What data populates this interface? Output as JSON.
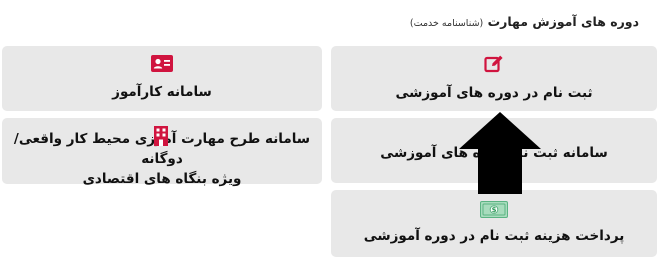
{
  "header": {
    "title": "دوره های آموزش مهارت",
    "subtitle": "(شناسنامه خدمت)"
  },
  "cards": {
    "register_course": {
      "label": "ثبت نام در دوره های آموزشی",
      "icon": "edit-icon"
    },
    "courses_system": {
      "label": "سامانه ثبت نام دوره های آموزشی",
      "icon": "none"
    },
    "payment": {
      "label": "پرداخت هزینه ثبت نام در دوره آموزشی",
      "icon": "banknote-icon"
    },
    "karamooz": {
      "label": "سامانه کارآموز",
      "icon": "id-card-icon"
    },
    "workplace_plan": {
      "label_line1": "سامانه طرح مهارت آموزی محیط کار واقعی/",
      "label_line2": "دوگانه",
      "label_line3": "ویژه بنگاه های اقتصادی",
      "icon": "building-icon"
    }
  },
  "overlay": {
    "icon": "up-arrow-icon"
  },
  "colors": {
    "accent_red": "#d0143f",
    "accent_green": "#2e9a5a",
    "card_bg": "#e8e8e8"
  }
}
